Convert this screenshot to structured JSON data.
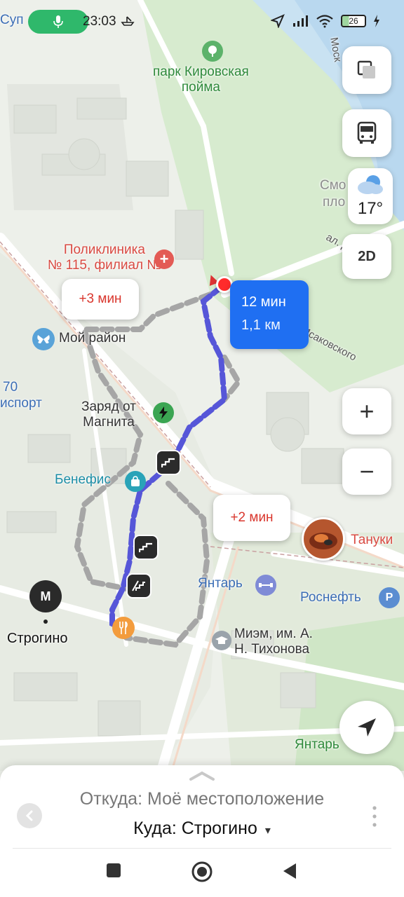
{
  "status_bar": {
    "time": "23:03",
    "battery": "26",
    "carrier_fragment": "Суп"
  },
  "map": {
    "labels": {
      "park": "парк Кировская\nпойма",
      "smo": "Смо",
      "plo": "пло",
      "clinic": "Поликлиника\n№ 115, филиал №",
      "my_district": "Мой район",
      "num70": "70",
      "sport": "испорт",
      "charge": "Заряд от\nМагнита",
      "benefis": "Бенефис",
      "yantar": "Янтарь",
      "rosneft": "Роснефть",
      "tanuki": "Тануки",
      "miem": "Миэм, им. А.\nН. Тихонова",
      "strogino_station": "Строгино",
      "metro_letter": "М",
      "yantar_bottom": "Янтарь",
      "street_isakovsky": "ул. Исаковского",
      "street_al": "ал. Д",
      "street_mos": "Моск"
    },
    "route": {
      "main_time": "12 мин",
      "main_distance": "1,1 км",
      "alt1": "+3 мин",
      "alt2": "+2 мин"
    }
  },
  "controls": {
    "layers_icon": "layers-icon",
    "transit_icon": "bus-icon",
    "weather_temp": "17°",
    "mode_label": "2D",
    "zoom_in": "+",
    "zoom_out": "−"
  },
  "sheet": {
    "from_label": "Откуда: Моё местоположение",
    "to_label": "Куда: Строгино",
    "to_caret": "▾"
  },
  "colors": {
    "route_main": "#5a5ad6",
    "route_alt": "#a9a9a9",
    "accent_blue": "#1f6ff2",
    "alt_text": "#d9362d"
  }
}
